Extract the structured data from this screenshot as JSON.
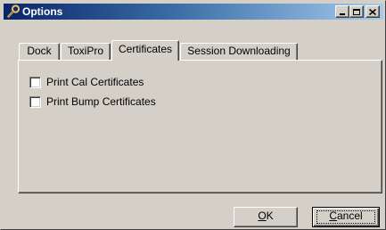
{
  "window": {
    "title": "Options"
  },
  "tabs": [
    {
      "label": "Dock"
    },
    {
      "label": "ToxiPro"
    },
    {
      "label": "Certificates",
      "active": true
    },
    {
      "label": "Session Downloading"
    }
  ],
  "checkboxes": [
    {
      "label": "Print Cal Certificates",
      "checked": false
    },
    {
      "label": "Print Bump Certificates",
      "checked": false
    }
  ],
  "buttons": {
    "ok_mnemonic": "O",
    "ok_rest": "K",
    "cancel_mnemonic": "C",
    "cancel_rest": "ancel"
  },
  "colors": {
    "titlebar_start": "#0a246a",
    "titlebar_end": "#a6caf0",
    "face": "#d4d0c8"
  }
}
